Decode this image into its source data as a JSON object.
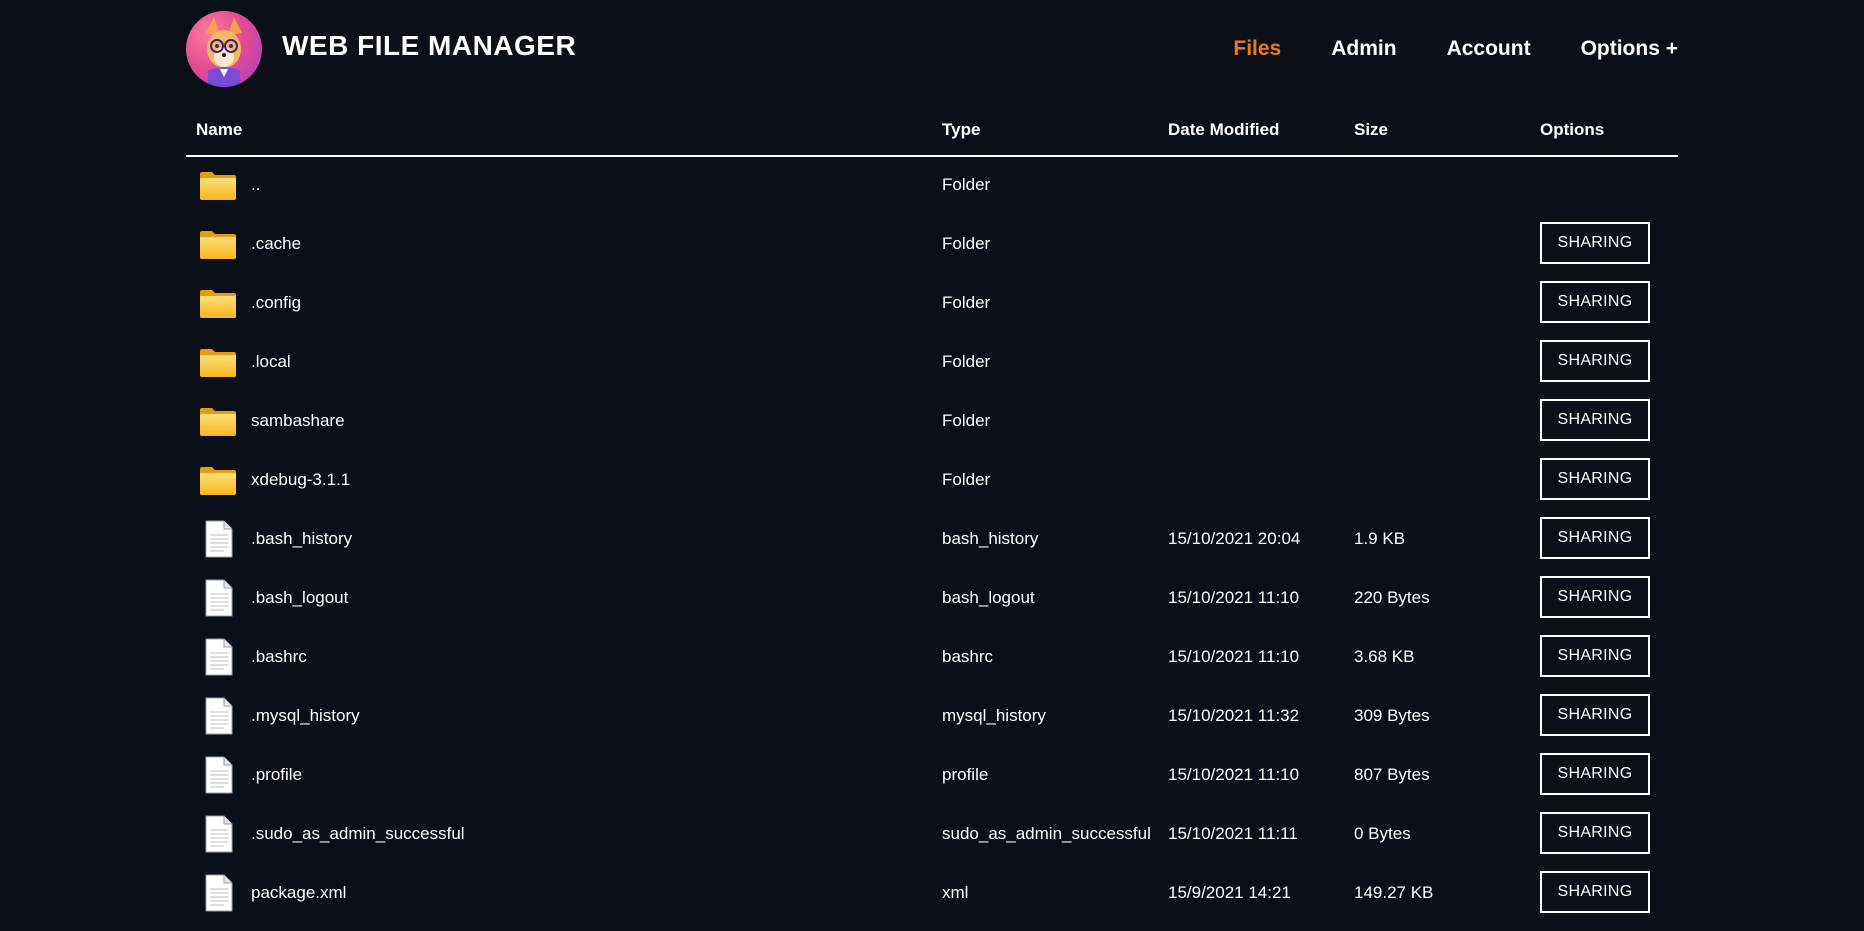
{
  "header": {
    "brand": "WEB FILE MANAGER",
    "nav": [
      "Files",
      "Admin",
      "Account",
      "Options +"
    ],
    "active_nav": "Files",
    "accent_color": "#ef7a12"
  },
  "table": {
    "columns": {
      "name": "Name",
      "type": "Type",
      "date": "Date Modified",
      "size": "Size",
      "options": "Options"
    },
    "share_label": "SHARING",
    "rows": [
      {
        "icon": "folder-icon",
        "name": "..",
        "type": "Folder",
        "date": "",
        "size": "",
        "share": false
      },
      {
        "icon": "folder-icon",
        "name": ".cache",
        "type": "Folder",
        "date": "",
        "size": "",
        "share": true
      },
      {
        "icon": "folder-icon",
        "name": ".config",
        "type": "Folder",
        "date": "",
        "size": "",
        "share": true
      },
      {
        "icon": "folder-icon",
        "name": ".local",
        "type": "Folder",
        "date": "",
        "size": "",
        "share": true
      },
      {
        "icon": "folder-icon",
        "name": "sambashare",
        "type": "Folder",
        "date": "",
        "size": "",
        "share": true
      },
      {
        "icon": "folder-icon",
        "name": "xdebug-3.1.1",
        "type": "Folder",
        "date": "",
        "size": "",
        "share": true
      },
      {
        "icon": "file-icon",
        "name": ".bash_history",
        "type": "bash_history",
        "date": "15/10/2021 20:04",
        "size": "1.9 KB",
        "share": true
      },
      {
        "icon": "file-icon",
        "name": ".bash_logout",
        "type": "bash_logout",
        "date": "15/10/2021 11:10",
        "size": "220 Bytes",
        "share": true
      },
      {
        "icon": "file-icon",
        "name": ".bashrc",
        "type": "bashrc",
        "date": "15/10/2021 11:10",
        "size": "3.68 KB",
        "share": true
      },
      {
        "icon": "file-icon",
        "name": ".mysql_history",
        "type": "mysql_history",
        "date": "15/10/2021 11:32",
        "size": "309 Bytes",
        "share": true
      },
      {
        "icon": "file-icon",
        "name": ".profile",
        "type": "profile",
        "date": "15/10/2021 11:10",
        "size": "807 Bytes",
        "share": true
      },
      {
        "icon": "file-icon",
        "name": ".sudo_as_admin_successful",
        "type": "sudo_as_admin_successful",
        "date": "15/10/2021 11:11",
        "size": "0 Bytes",
        "share": true
      },
      {
        "icon": "file-icon",
        "name": "package.xml",
        "type": "xml",
        "date": "15/9/2021 14:21",
        "size": "149.27 KB",
        "share": true
      }
    ]
  }
}
